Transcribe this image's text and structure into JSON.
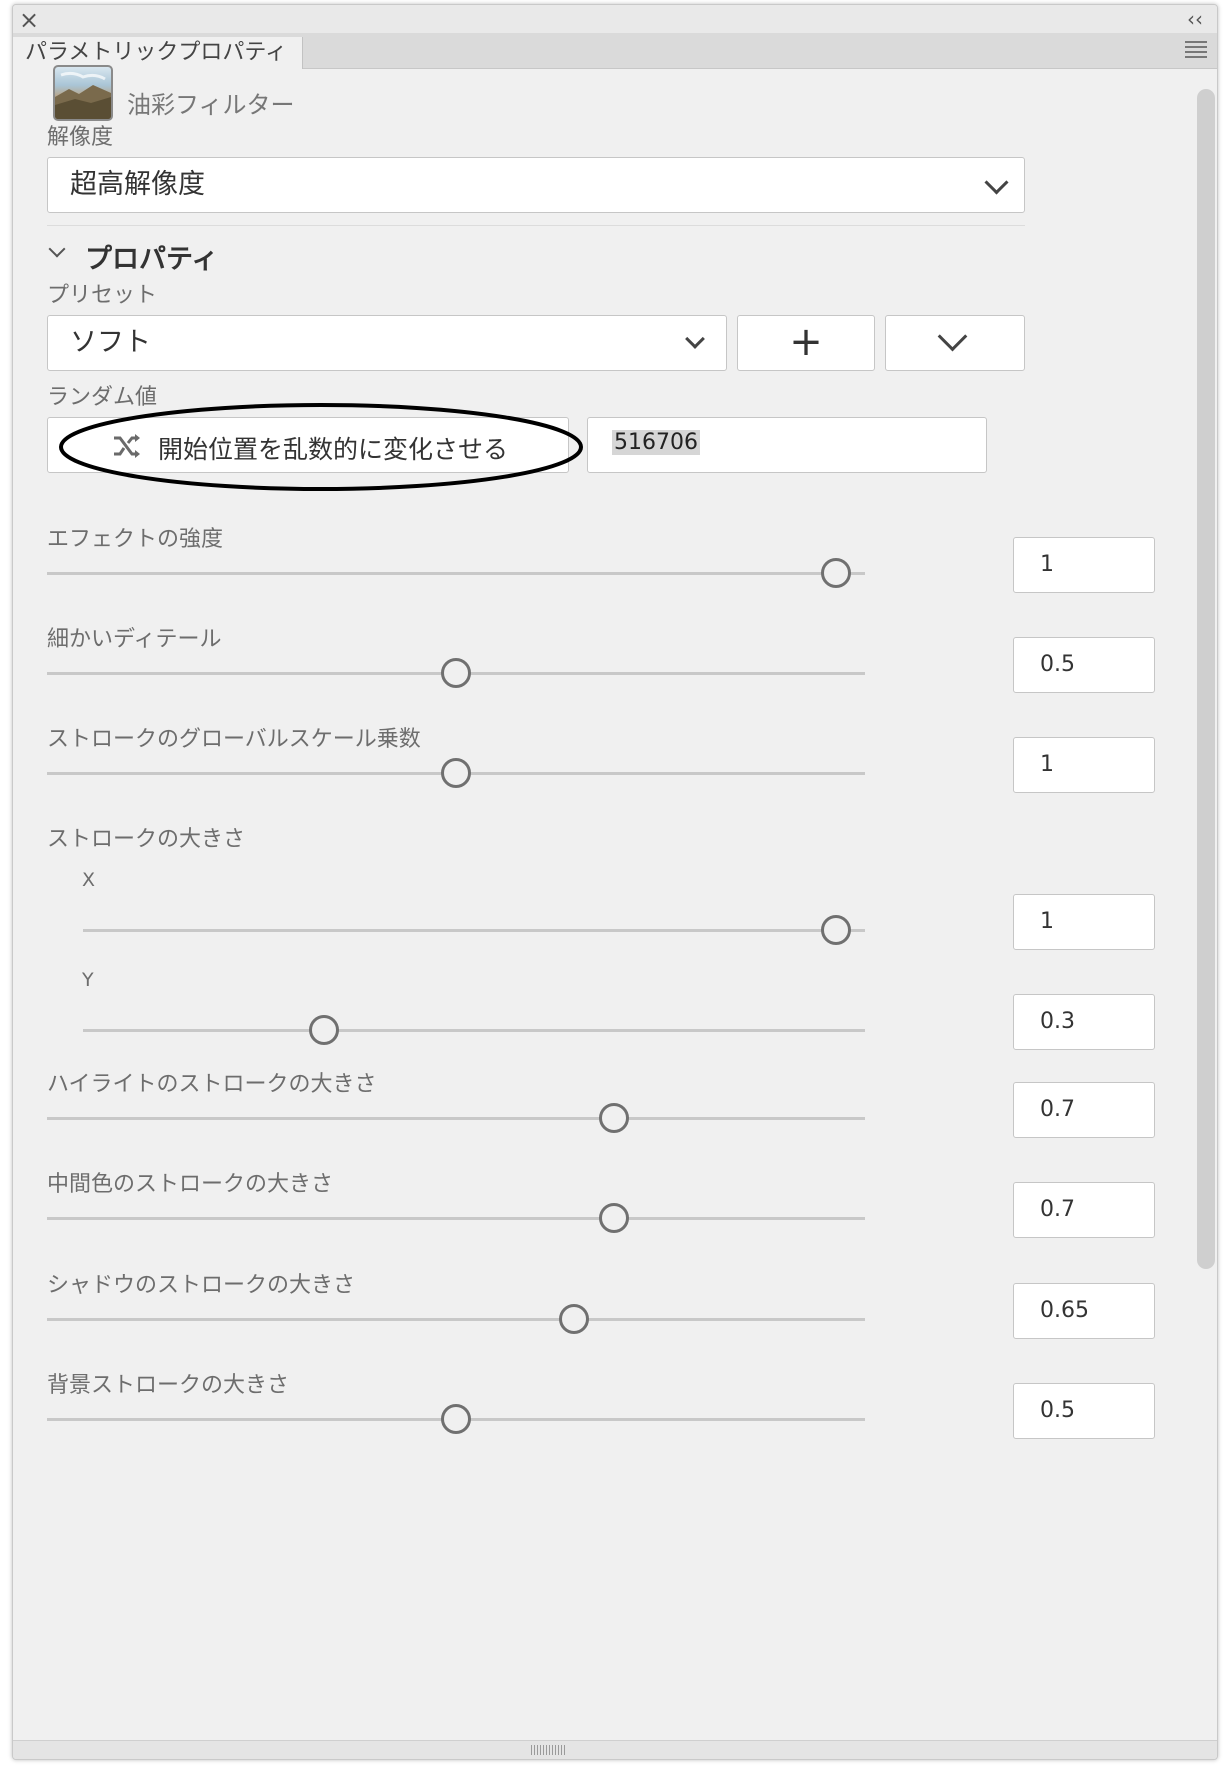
{
  "panel": {
    "title_tab": "パラメトリックプロパティ"
  },
  "filter": {
    "name": "油彩フィルター"
  },
  "resolution": {
    "label": "解像度",
    "value": "超高解像度"
  },
  "properties": {
    "title": "プロパティ",
    "preset_label": "プリセット",
    "preset_value": "ソフト",
    "add_button": "+",
    "random_label": "ランダム値",
    "randomize_button": "開始位置を乱数的に変化させる",
    "seed_value": "516706"
  },
  "sliders": [
    {
      "label": "エフェクトの強度",
      "value": "1",
      "fraction": 1.0
    },
    {
      "label": "細かいディテール",
      "value": "0.5",
      "fraction": 0.5
    },
    {
      "label": "ストロークのグローバルスケール乗数",
      "value": "1",
      "fraction": 0.5
    }
  ],
  "stroke_size": {
    "label": "ストロークの大きさ",
    "x_label": "X",
    "x_value": "1",
    "x_fraction": 1.0,
    "y_label": "Y",
    "y_value": "0.3",
    "y_fraction": 0.3
  },
  "sliders2": [
    {
      "label": "ハイライトのストロークの大きさ",
      "value": "0.7",
      "fraction": 0.7
    },
    {
      "label": "中間色のストロークの大きさ",
      "value": "0.7",
      "fraction": 0.7
    },
    {
      "label": "シャドウのストロークの大きさ",
      "value": "0.65",
      "fraction": 0.65
    },
    {
      "label": "背景ストロークの大きさ",
      "value": "0.5",
      "fraction": 0.5
    }
  ],
  "colors": {
    "panel_bg": "#f0f0f0",
    "knob": "#707070",
    "track": "#c8c8c8",
    "annotation_ellipse": "#000000"
  },
  "icons": [
    "close-icon",
    "collapse-icon",
    "panel-menu-icon",
    "chevron-down-icon",
    "plus-icon",
    "shuffle-icon"
  ]
}
